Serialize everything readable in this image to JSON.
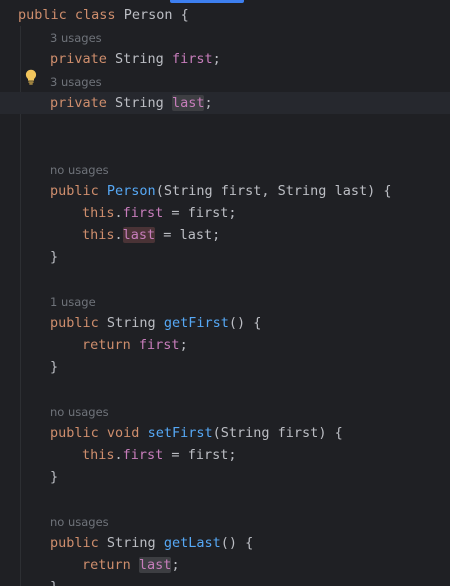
{
  "editor": {
    "usage_hints": {
      "field_first": "3 usages",
      "field_last": "3 usages",
      "constructor": "no usages",
      "get_first": "1 usage",
      "set_first": "no usages",
      "get_last": "no usages"
    },
    "tokens": {
      "kw_public": "public",
      "kw_class": "class",
      "kw_private": "private",
      "kw_this": "this",
      "kw_return": "return",
      "kw_void": "void",
      "type_string": "String",
      "class_name": "Person",
      "field_first": "first",
      "field_last": "last",
      "param_first": "first",
      "param_last": "last",
      "method_get_first": "getFirst",
      "method_set_first": "setFirst",
      "method_get_last": "getLast",
      "open_brace": "{",
      "close_brace": "}",
      "semicolon": ";",
      "dot": ".",
      "assign": " = ",
      "comma": ", ",
      "lparen": "(",
      "rparen": ")",
      "empty_parens_brace": "() {",
      "rparen_brace": ") {"
    },
    "icons": {
      "intention_bulb": "lightbulb-icon"
    },
    "colors": {
      "background": "#1f2024",
      "keyword": "#cf8e6d",
      "field": "#c77dbb",
      "method_declaration": "#56a8f5",
      "default_text": "#bcbec4",
      "hint": "#6f737a",
      "tab_accent": "#3d7ff0"
    }
  }
}
